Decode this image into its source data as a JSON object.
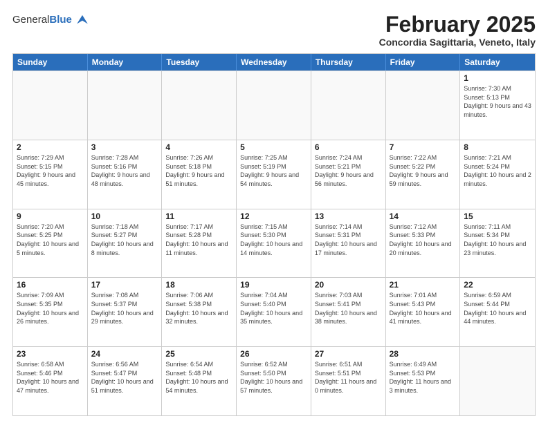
{
  "header": {
    "logo_general": "General",
    "logo_blue": "Blue",
    "month_title": "February 2025",
    "location": "Concordia Sagittaria, Veneto, Italy"
  },
  "weekdays": [
    "Sunday",
    "Monday",
    "Tuesday",
    "Wednesday",
    "Thursday",
    "Friday",
    "Saturday"
  ],
  "rows": [
    [
      {
        "day": "",
        "info": ""
      },
      {
        "day": "",
        "info": ""
      },
      {
        "day": "",
        "info": ""
      },
      {
        "day": "",
        "info": ""
      },
      {
        "day": "",
        "info": ""
      },
      {
        "day": "",
        "info": ""
      },
      {
        "day": "1",
        "info": "Sunrise: 7:30 AM\nSunset: 5:13 PM\nDaylight: 9 hours and 43 minutes."
      }
    ],
    [
      {
        "day": "2",
        "info": "Sunrise: 7:29 AM\nSunset: 5:15 PM\nDaylight: 9 hours and 45 minutes."
      },
      {
        "day": "3",
        "info": "Sunrise: 7:28 AM\nSunset: 5:16 PM\nDaylight: 9 hours and 48 minutes."
      },
      {
        "day": "4",
        "info": "Sunrise: 7:26 AM\nSunset: 5:18 PM\nDaylight: 9 hours and 51 minutes."
      },
      {
        "day": "5",
        "info": "Sunrise: 7:25 AM\nSunset: 5:19 PM\nDaylight: 9 hours and 54 minutes."
      },
      {
        "day": "6",
        "info": "Sunrise: 7:24 AM\nSunset: 5:21 PM\nDaylight: 9 hours and 56 minutes."
      },
      {
        "day": "7",
        "info": "Sunrise: 7:22 AM\nSunset: 5:22 PM\nDaylight: 9 hours and 59 minutes."
      },
      {
        "day": "8",
        "info": "Sunrise: 7:21 AM\nSunset: 5:24 PM\nDaylight: 10 hours and 2 minutes."
      }
    ],
    [
      {
        "day": "9",
        "info": "Sunrise: 7:20 AM\nSunset: 5:25 PM\nDaylight: 10 hours and 5 minutes."
      },
      {
        "day": "10",
        "info": "Sunrise: 7:18 AM\nSunset: 5:27 PM\nDaylight: 10 hours and 8 minutes."
      },
      {
        "day": "11",
        "info": "Sunrise: 7:17 AM\nSunset: 5:28 PM\nDaylight: 10 hours and 11 minutes."
      },
      {
        "day": "12",
        "info": "Sunrise: 7:15 AM\nSunset: 5:30 PM\nDaylight: 10 hours and 14 minutes."
      },
      {
        "day": "13",
        "info": "Sunrise: 7:14 AM\nSunset: 5:31 PM\nDaylight: 10 hours and 17 minutes."
      },
      {
        "day": "14",
        "info": "Sunrise: 7:12 AM\nSunset: 5:33 PM\nDaylight: 10 hours and 20 minutes."
      },
      {
        "day": "15",
        "info": "Sunrise: 7:11 AM\nSunset: 5:34 PM\nDaylight: 10 hours and 23 minutes."
      }
    ],
    [
      {
        "day": "16",
        "info": "Sunrise: 7:09 AM\nSunset: 5:35 PM\nDaylight: 10 hours and 26 minutes."
      },
      {
        "day": "17",
        "info": "Sunrise: 7:08 AM\nSunset: 5:37 PM\nDaylight: 10 hours and 29 minutes."
      },
      {
        "day": "18",
        "info": "Sunrise: 7:06 AM\nSunset: 5:38 PM\nDaylight: 10 hours and 32 minutes."
      },
      {
        "day": "19",
        "info": "Sunrise: 7:04 AM\nSunset: 5:40 PM\nDaylight: 10 hours and 35 minutes."
      },
      {
        "day": "20",
        "info": "Sunrise: 7:03 AM\nSunset: 5:41 PM\nDaylight: 10 hours and 38 minutes."
      },
      {
        "day": "21",
        "info": "Sunrise: 7:01 AM\nSunset: 5:43 PM\nDaylight: 10 hours and 41 minutes."
      },
      {
        "day": "22",
        "info": "Sunrise: 6:59 AM\nSunset: 5:44 PM\nDaylight: 10 hours and 44 minutes."
      }
    ],
    [
      {
        "day": "23",
        "info": "Sunrise: 6:58 AM\nSunset: 5:46 PM\nDaylight: 10 hours and 47 minutes."
      },
      {
        "day": "24",
        "info": "Sunrise: 6:56 AM\nSunset: 5:47 PM\nDaylight: 10 hours and 51 minutes."
      },
      {
        "day": "25",
        "info": "Sunrise: 6:54 AM\nSunset: 5:48 PM\nDaylight: 10 hours and 54 minutes."
      },
      {
        "day": "26",
        "info": "Sunrise: 6:52 AM\nSunset: 5:50 PM\nDaylight: 10 hours and 57 minutes."
      },
      {
        "day": "27",
        "info": "Sunrise: 6:51 AM\nSunset: 5:51 PM\nDaylight: 11 hours and 0 minutes."
      },
      {
        "day": "28",
        "info": "Sunrise: 6:49 AM\nSunset: 5:53 PM\nDaylight: 11 hours and 3 minutes."
      },
      {
        "day": "",
        "info": ""
      }
    ]
  ]
}
